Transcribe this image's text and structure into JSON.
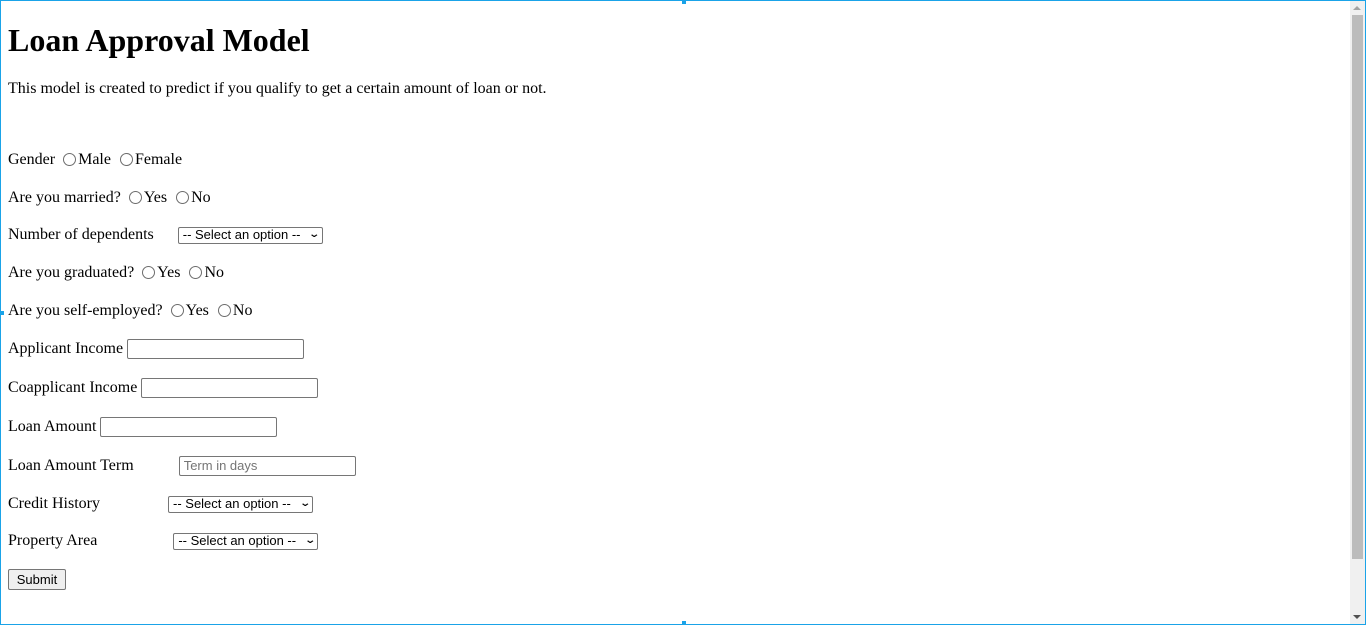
{
  "page": {
    "title": "Loan Approval Model",
    "description": "This model is created to predict if you qualify to get a certain amount of loan or not."
  },
  "form": {
    "gender": {
      "label": "Gender",
      "options": [
        "Male",
        "Female"
      ]
    },
    "married": {
      "label": "Are you married?",
      "options": [
        "Yes",
        "No"
      ]
    },
    "dependents": {
      "label": "Number of dependents",
      "selected": "-- Select an option --"
    },
    "graduated": {
      "label": "Are you graduated?",
      "options": [
        "Yes",
        "No"
      ]
    },
    "self_employed": {
      "label": "Are you self-employed?",
      "options": [
        "Yes",
        "No"
      ]
    },
    "applicant_income": {
      "label": "Applicant Income",
      "value": ""
    },
    "coapplicant_income": {
      "label": "Coapplicant Income",
      "value": ""
    },
    "loan_amount": {
      "label": "Loan Amount",
      "value": ""
    },
    "loan_amount_term": {
      "label": "Loan Amount Term",
      "value": "",
      "placeholder": "Term in days"
    },
    "credit_history": {
      "label": "Credit History",
      "selected": "-- Select an option --"
    },
    "property_area": {
      "label": "Property Area",
      "selected": "-- Select an option --"
    },
    "submit_label": "Submit"
  },
  "colors": {
    "frame_border": "#1aa3e8",
    "scroll_thumb": "#bcbcbc"
  }
}
